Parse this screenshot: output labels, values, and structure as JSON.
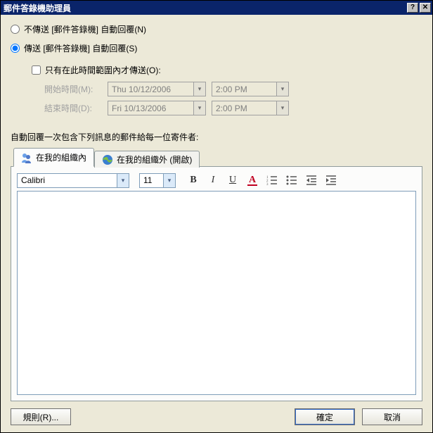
{
  "titlebar": {
    "title": "郵件答錄機助理員",
    "help_symbol": "?",
    "close_symbol": "✕"
  },
  "radios": {
    "dont_send": "不傳送 [郵件答錄機] 自動回覆(N)",
    "send": "傳送 [郵件答錄機] 自動回覆(S)"
  },
  "time_section": {
    "checkbox_label": "只有在此時間範圍內才傳送(O):",
    "start_label": "開始時間(M):",
    "end_label": "結束時間(D):",
    "start_date": "Thu 10/12/2006",
    "start_time": "2:00 PM",
    "end_date": "Fri 10/13/2006",
    "end_time": "2:00 PM",
    "dropdown_arrow": "▾"
  },
  "reply_label": "自動回覆一次包含下列訊息的郵件給每一位寄件者:",
  "tabs": {
    "inside": "在我的組織內",
    "outside": "在我的組織外 (開啟)"
  },
  "format": {
    "font": "Calibri",
    "size": "11",
    "dropdown_arrow": "▾",
    "bold": "B",
    "italic": "I",
    "underline": "U",
    "color_a": "A"
  },
  "footer": {
    "rules": "規則(R)...",
    "ok": "確定",
    "cancel": "取消"
  }
}
